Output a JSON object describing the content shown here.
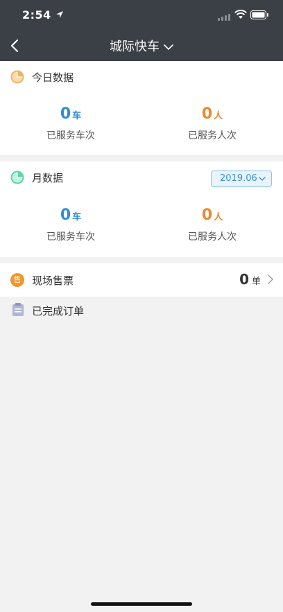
{
  "status_bar": {
    "time": "2:54"
  },
  "nav": {
    "title": "城际快车"
  },
  "today": {
    "title": "今日数据",
    "trips_value": "0",
    "trips_unit": "车",
    "trips_label": "已服务车次",
    "people_value": "0",
    "people_unit": "人",
    "people_label": "已服务人次"
  },
  "month": {
    "title": "月数据",
    "selected_month": "2019.06",
    "trips_value": "0",
    "trips_unit": "车",
    "trips_label": "已服务车次",
    "people_value": "0",
    "people_unit": "人",
    "people_label": "已服务人次"
  },
  "ticket_sales": {
    "icon_text": "售",
    "title": "现场售票",
    "count": "0",
    "count_unit": "单"
  },
  "completed_orders": {
    "title": "已完成订单"
  },
  "colors": {
    "header_bg": "#3b4047",
    "accent_blue": "#2b8fd6",
    "accent_orange": "#e98a2f",
    "today_icon": "#efb45f",
    "month_icon": "#5fd4a6",
    "ticket_icon": "#f0962d",
    "orders_icon": "#aeb6d2"
  },
  "icons": {
    "back": "chevron-left-icon",
    "title_dropdown": "chevron-down-icon",
    "today": "pie-chart-icon",
    "month": "pie-chart-icon",
    "orders": "clipboard-icon",
    "ticket_arrow": "chevron-right-icon"
  }
}
